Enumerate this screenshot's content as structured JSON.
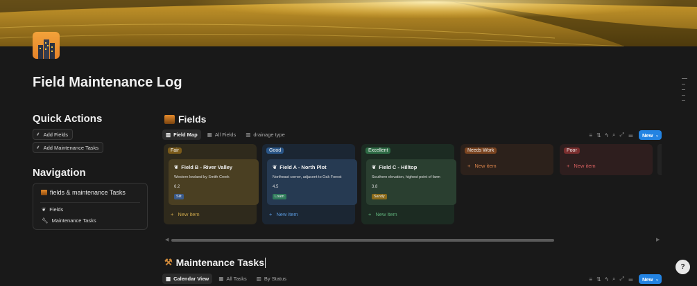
{
  "page": {
    "title": "Field Maintenance Log",
    "icon": "city-buildings-icon"
  },
  "quick_actions": {
    "heading": "Quick Actions",
    "buttons": [
      {
        "label": "Add Fields",
        "icon": "wheat-icon"
      },
      {
        "label": "Add Maintenance Tasks",
        "icon": "wheat-icon"
      }
    ]
  },
  "navigation": {
    "heading": "Navigation",
    "box_title": "fields & maintenance Tasks",
    "items": [
      {
        "label": "Fields",
        "icon": "leaf-icon"
      },
      {
        "label": "Maintenance Tasks",
        "icon": "wrench-icon"
      }
    ]
  },
  "fields_db": {
    "title": "Fields",
    "icon": "farm-icon",
    "tabs": [
      {
        "label": "Field Map",
        "active": true
      },
      {
        "label": "All Fields",
        "active": false
      },
      {
        "label": "drainage type",
        "active": false
      }
    ],
    "new_label": "New",
    "new_item_label": "New item",
    "columns": [
      {
        "label": "Fair",
        "bg": "#2f2a1c",
        "label_bg": "#7a5a1a",
        "text_color": "#c9a54a",
        "card": {
          "title": "Field B - River Valley",
          "desc": "Western lowland by Smith Creek",
          "value": "6.2",
          "tag": "Silt",
          "tag_bg": "#3a5a8a",
          "bg": "#4a3f22"
        }
      },
      {
        "label": "Good",
        "bg": "#1b2633",
        "label_bg": "#2a5688",
        "text_color": "#5b9be0",
        "card": {
          "title": "Field A - North Plot",
          "desc": "Northeast corner, adjacent to Oak Forest",
          "value": "4.5",
          "tag": "Loam",
          "tag_bg": "#2e7a5a",
          "bg": "#263a52"
        }
      },
      {
        "label": "Excellent",
        "bg": "#1c2b22",
        "label_bg": "#2e6b45",
        "text_color": "#5fb07a",
        "card": {
          "title": "Field C - Hilltop",
          "desc": "Southern elevation, highest point of farm",
          "value": "3.8",
          "tag": "Sandy",
          "tag_bg": "#8a6a1a",
          "bg": "#2a3f30"
        }
      },
      {
        "label": "Needs Work",
        "bg": "#2c211b",
        "label_bg": "#7a4420",
        "text_color": "#d8824a",
        "card": null
      },
      {
        "label": "Poor",
        "bg": "#2e1e1e",
        "label_bg": "#7a2e2e",
        "text_color": "#d86060",
        "card": null
      }
    ]
  },
  "tasks_db": {
    "title": "Maintenance Tasks",
    "icon": "hammer-pick-icon",
    "tabs": [
      {
        "label": "Calendar View",
        "active": true
      },
      {
        "label": "All Tasks",
        "active": false
      },
      {
        "label": "By Status",
        "active": false
      }
    ],
    "new_label": "New"
  },
  "colors": {
    "accent": "#2383e2",
    "background": "#191919"
  }
}
